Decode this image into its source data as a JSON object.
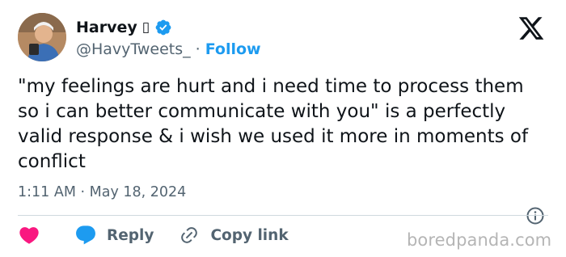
{
  "author": {
    "name": "Harvey",
    "name_suffix_glyph": "▯",
    "verified_icon": "verified-badge-icon",
    "handle": "@HavyTweets_",
    "separator": "·",
    "follow_label": "Follow"
  },
  "tweet": {
    "text": "\"my feelings are hurt and i need time to process them so i can better communicate with you\" is a perfectly valid response & i wish we used it more in moments of conflict",
    "timestamp": "1:11 AM · May 18, 2024"
  },
  "actions": {
    "like_icon": "heart-icon",
    "reply_label": "Reply",
    "copy_link_label": "Copy link"
  },
  "watermark": "boredpanda.com",
  "colors": {
    "accent": "#1d9bf0",
    "like": "#f91880",
    "text": "#0f1419",
    "secondary": "#536471"
  }
}
